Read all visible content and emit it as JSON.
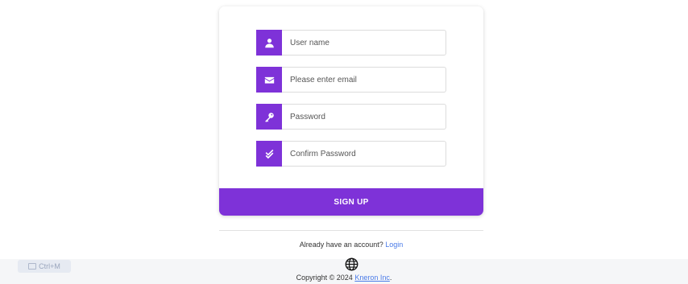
{
  "form": {
    "username": {
      "placeholder": "User name",
      "icon": "user-icon"
    },
    "email": {
      "placeholder": "Please enter email",
      "icon": "envelope-icon"
    },
    "password": {
      "placeholder": "Password",
      "icon": "key-icon"
    },
    "confirm_password": {
      "placeholder": "Confirm Password",
      "icon": "double-check-icon"
    },
    "signup_label": "SIGN UP"
  },
  "login_prompt": {
    "text": "Already have an account?",
    "link_label": "Login"
  },
  "footer": {
    "copyright_prefix": "Copyright © 2024",
    "company_link": "Kneron Inc",
    "suffix": "."
  },
  "shortcut_badge": {
    "label": "Ctrl+M"
  },
  "colors": {
    "accent": "#7e32d8",
    "link": "#4a7be8"
  }
}
